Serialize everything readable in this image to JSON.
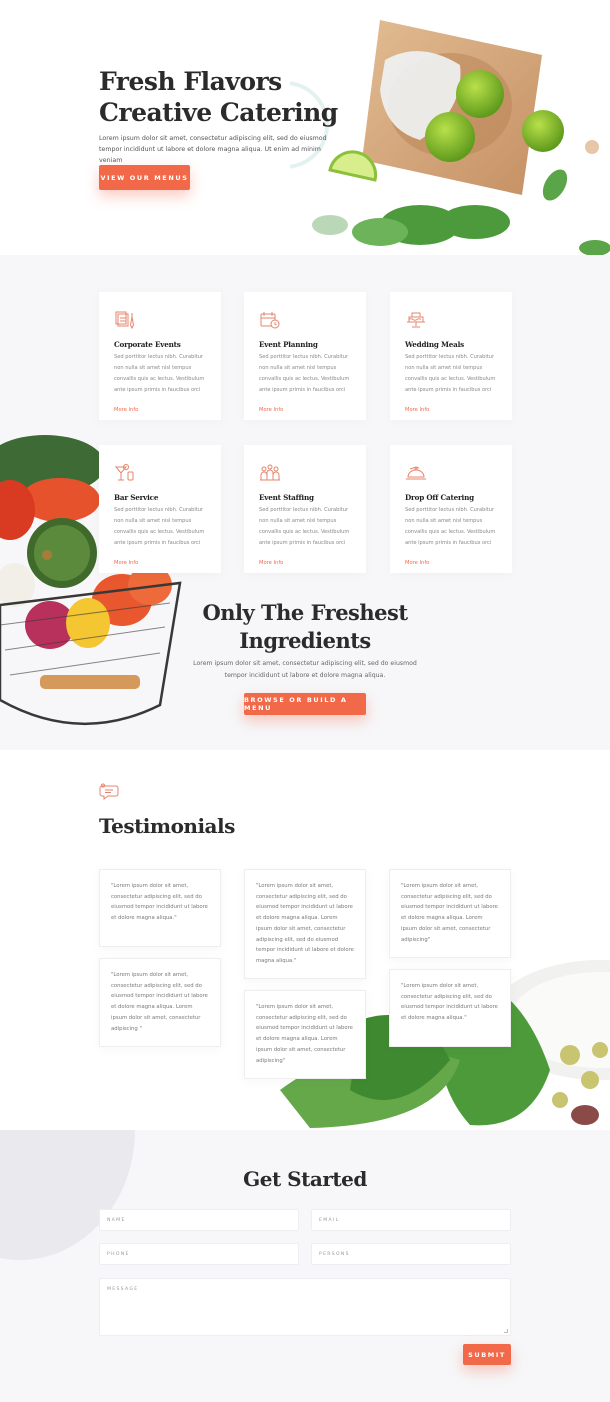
{
  "colors": {
    "accent": "#f2694a",
    "icon": "#e5846c",
    "section_bg": "#f7f7f9",
    "heading": "#2b2b2b"
  },
  "hero": {
    "title_line1": "Fresh Flavors",
    "title_line2": "Creative Catering",
    "text": "Lorem ipsum dolor sit amet, consectetur adipiscing elit, sed do eiusmod tempor incididunt ut labore et dolore magna aliqua. Ut enim ad minim veniam",
    "button_label": "View Our Menus"
  },
  "services": {
    "items": [
      {
        "icon": "corporate-icon",
        "title": "Corporate Events",
        "text": "Sed porttitor lectus nibh. Curabitur non nulla sit amet nisl tempus convallis quis ac lectus. Vestibulum ante ipsum primis in faucibus orci",
        "link": "More Info"
      },
      {
        "icon": "calendar-icon",
        "title": "Event Planning",
        "text": "Sed porttitor lectus nibh. Curabitur non nulla sit amet nisl tempus convallis quis ac lectus. Vestibulum ante ipsum primis in faucibus orci",
        "link": "More Info"
      },
      {
        "icon": "cake-icon",
        "title": "Wedding Meals",
        "text": "Sed porttitor lectus nibh. Curabitur non nulla sit amet nisl tempus convallis quis ac lectus. Vestibulum ante ipsum primis in faucibus orci",
        "link": "More Info"
      },
      {
        "icon": "cocktail-icon",
        "title": "Bar Service",
        "text": "Sed porttitor lectus nibh. Curabitur non nulla sit amet nisl tempus convallis quis ac lectus. Vestibulum ante ipsum primis in faucibus orci",
        "link": "More Info"
      },
      {
        "icon": "staff-icon",
        "title": "Event Staffing",
        "text": "Sed porttitor lectus nibh. Curabitur non nulla sit amet nisl tempus convallis quis ac lectus. Vestibulum ante ipsum primis in faucibus orci",
        "link": "More Info"
      },
      {
        "icon": "cloche-icon",
        "title": "Drop Off Catering",
        "text": "Sed porttitor lectus nibh. Curabitur non nulla sit amet nisl tempus convallis quis ac lectus. Vestibulum ante ipsum primis in faucibus orci",
        "link": "More Info"
      }
    ]
  },
  "freshest": {
    "title_line1": "Only The Freshest",
    "title_line2": "Ingredients",
    "text": "Lorem ipsum dolor sit amet, consectetur adipiscing elit, sed do eiusmod tempor incididunt ut labore et dolore magna aliqua.",
    "button_label": "Browse or Build a Menu"
  },
  "testimonials": {
    "title": "Testimonials",
    "items": [
      "\"Lorem ipsum dolor sit amet, consectetur adipiscing elit, sed do eiusmod tempor incididunt ut labore et dolore magna aliqua.\"",
      "\"Lorem ipsum dolor sit amet, consectetur adipiscing elit, sed do eiusmod tempor incididunt ut labore et dolore magna aliqua. Lorem ipsum dolor sit amet, consectetur adipiscing \"",
      "\"Lorem ipsum dolor sit amet, consectetur adipiscing elit, sed do eiusmod tempor incididunt ut labore et dolore magna aliqua. Lorem ipsum dolor sit amet, consectetur adipiscing elit, sed do eiusmod tempor incididunt ut labore et dolore magna aliqua.\"",
      "\"Lorem ipsum dolor sit amet, consectetur adipiscing elit, sed do eiusmod tempor incididunt ut labore et dolore magna aliqua. Lorem ipsum dolor sit amet, consectetur adipiscing\"",
      "\"Lorem ipsum dolor sit amet, consectetur adipiscing elit, sed do eiusmod tempor incididunt ut labore et dolore magna aliqua. Lorem ipsum dolor sit amet, consectetur adipiscing\"",
      "\"Lorem ipsum dolor sit amet, consectetur adipiscing elit, sed do eiusmod tempor incididunt ut labore et dolore magna aliqua.\""
    ]
  },
  "contact": {
    "title": "Get Started",
    "fields": {
      "name": "Name",
      "email": "Email",
      "phone": "Phone",
      "persons": "Persons",
      "message": "Message"
    },
    "submit_label": "Submit"
  }
}
